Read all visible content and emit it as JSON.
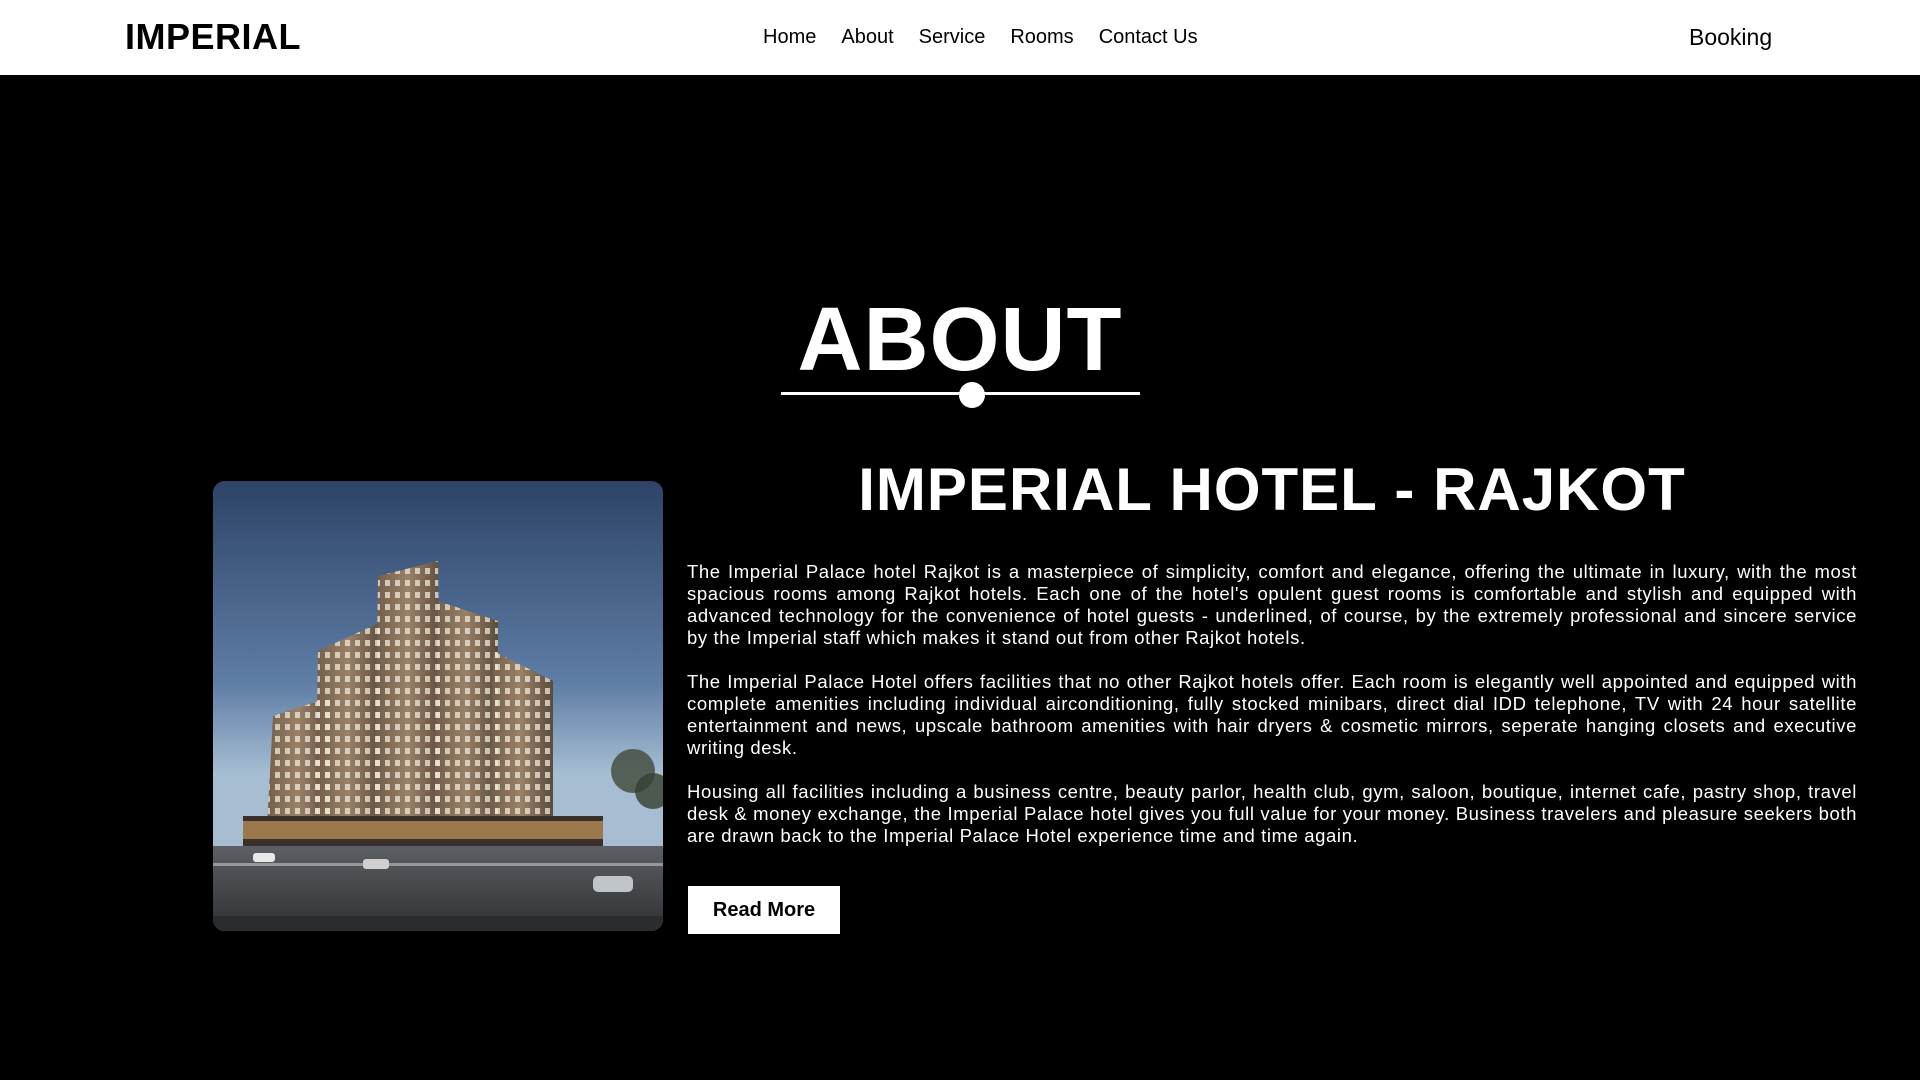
{
  "navbar": {
    "logo": "IMPERIAL",
    "links": [
      "Home",
      "About",
      "Service",
      "Rooms",
      "Contact Us"
    ],
    "booking": "Booking"
  },
  "about": {
    "section_title": "ABOUT",
    "hotel_heading": "IMPERIAL HOTEL - RAJKOT",
    "paragraphs": [
      "The Imperial Palace hotel Rajkot is a masterpiece of simplicity, comfort and elegance, offering the ultimate in luxury, with the most spacious rooms among Rajkot hotels. Each one of the hotel's opulent guest rooms is comfortable and stylish and equipped with advanced technology for the convenience of hotel guests - underlined, of course, by the extremely professional and sincere service by the Imperial staff which makes it stand out from other Rajkot hotels.",
      "The Imperial Palace Hotel offers facilities that no other Rajkot hotels offer. Each room is elegantly well appointed and equipped with complete amenities including individual airconditioning, fully stocked minibars, direct dial IDD telephone, TV with 24 hour satellite entertainment and news, upscale bathroom amenities with hair dryers & cosmetic mirrors, seperate hanging closets and executive writing desk.",
      "Housing all facilities including a business centre, beauty parlor, health club, gym, saloon, boutique, internet cafe, pastry shop, travel desk & money exchange, the Imperial Palace hotel gives you full value for your money. Business travelers and pleasure seekers both are drawn back to the Imperial Palace Hotel experience time and time again."
    ],
    "read_more_label": "Read More"
  },
  "colors": {
    "page_background": "#000000",
    "navbar_background": "#ffffff",
    "text_light": "#ffffff",
    "text_dark": "#000000"
  }
}
